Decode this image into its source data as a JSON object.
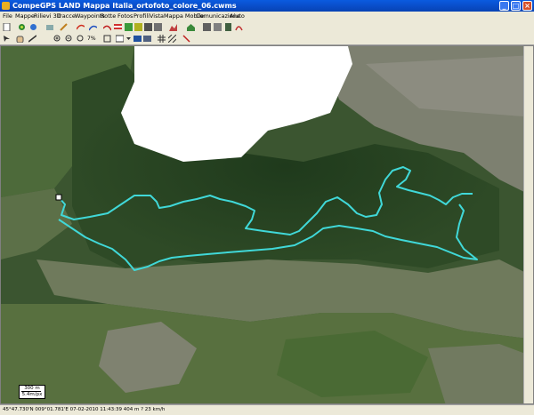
{
  "window": {
    "title": "CompeGPS LAND Mappa Italia_ortofoto_colore_06.cwms",
    "buttons": {
      "minimize": "_",
      "maximize": "□",
      "close": "×"
    }
  },
  "menu": {
    "items": [
      "File",
      "Mappe",
      "Rilievi 3D",
      "Tracce",
      "Waypoints",
      "Rotte",
      "Fotos",
      "Profili",
      "Vista",
      "Mappa Mobile",
      "Comunicazione",
      "Aiuto"
    ]
  },
  "toolbar": {
    "zoom_level": "7%"
  },
  "map": {
    "scale_label": "300 m",
    "scale_sub": "5.4m/px",
    "track_color": "#40d8d8",
    "blank_area_color": "#ffffff"
  },
  "status": {
    "text": "45°47.730'N 009°01.781'E  07-02-2010  11:43:39  404 m  ?  23 km/h"
  }
}
